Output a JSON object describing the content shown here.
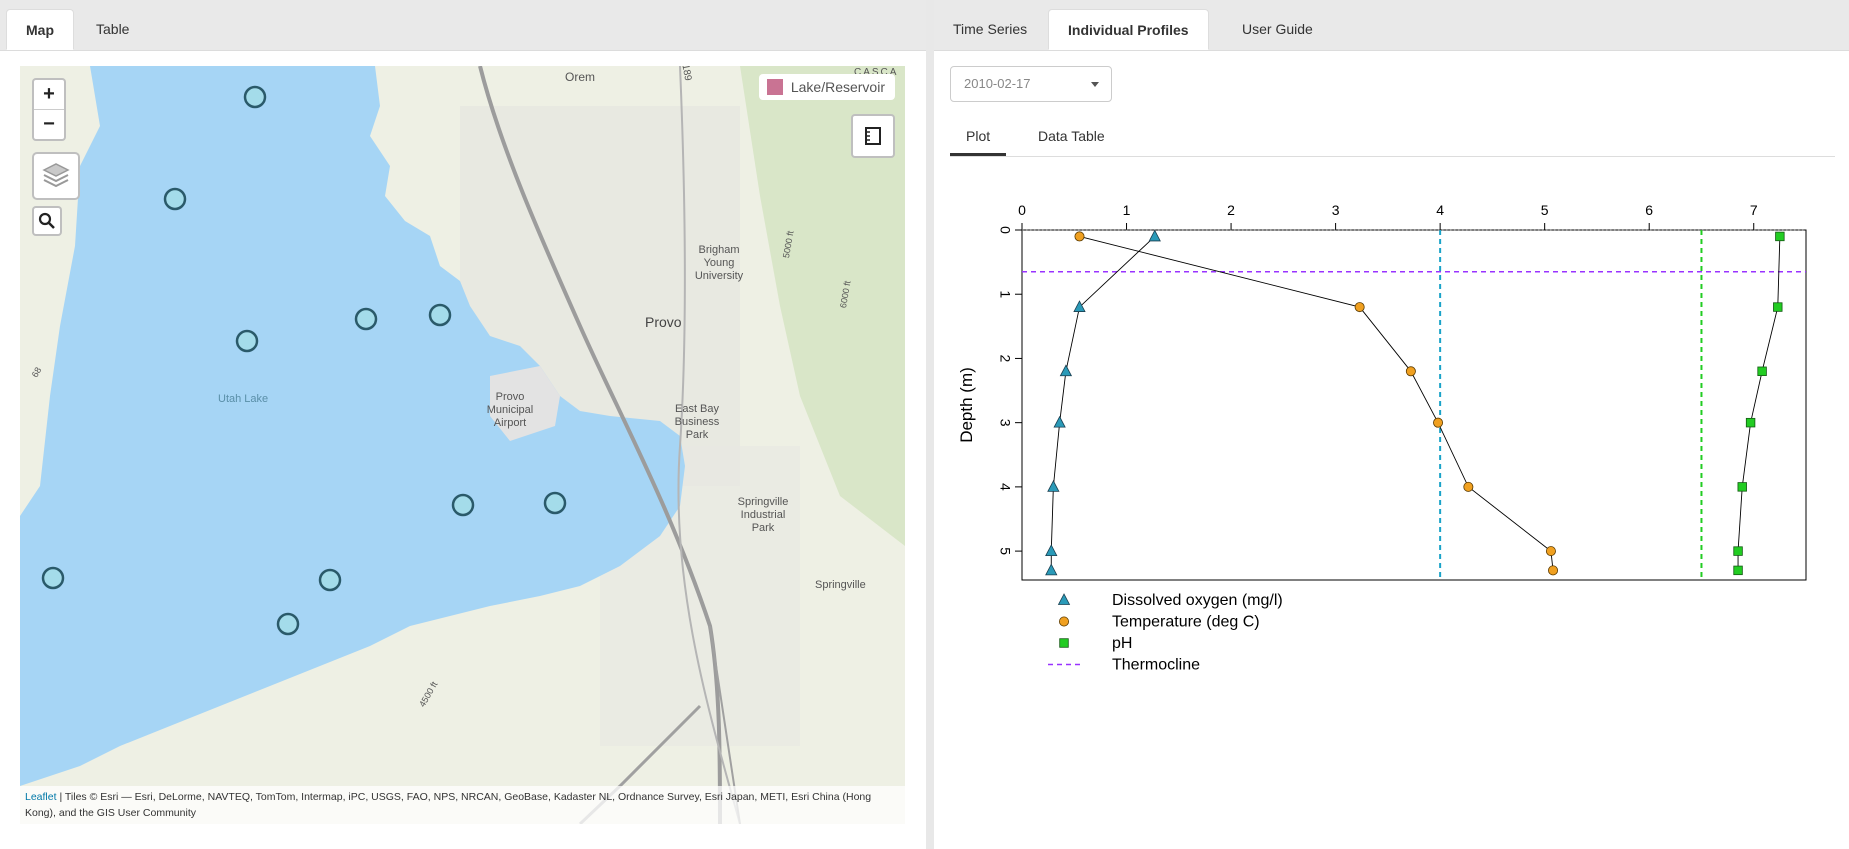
{
  "left_tabs": [
    {
      "label": "Map",
      "active": true
    },
    {
      "label": "Table",
      "active": false
    }
  ],
  "right_tabs": [
    {
      "label": "Time Series",
      "active": false
    },
    {
      "label": "Individual Profiles",
      "active": true
    },
    {
      "label": "User Guide",
      "active": false
    }
  ],
  "map": {
    "zoom_in": "+",
    "zoom_out": "−",
    "legend_label": "Lake/Reservoir",
    "legend_color": "#c97393",
    "place_labels": {
      "orem": "Orem",
      "provo": "Provo",
      "byu": "Brigham Young University",
      "airport": "Provo Municipal Airport",
      "east_bay": "East Bay Business Park",
      "springville_park": "Springville Industrial Park",
      "springville": "Springville",
      "utah_lake": "Utah Lake",
      "highway": "189",
      "road_68": "68",
      "scasca": "CASCA",
      "elev1": "5000 ft",
      "elev2": "4500 ft",
      "elev3": "6000 ft"
    },
    "attribution_link": "Leaflet",
    "attribution_text": " | Tiles © Esri — Esri, DeLorme, NAVTEQ, TomTom, Intermap, iPC, USGS, FAO, NPS, NRCAN, GeoBase, Kadaster NL, Ordnance Survey, Esri Japan, METI, Esri China (Hong Kong), and the GIS User Community",
    "lake_color": "#a6d5f5",
    "marker_color": "#a4dcea",
    "marker_stroke": "#2a5a6a"
  },
  "date_select": {
    "value": "2010-02-17"
  },
  "sub_tabs": [
    {
      "label": "Plot",
      "active": true
    },
    {
      "label": "Data Table",
      "active": false
    }
  ],
  "chart_data": {
    "type": "scatter",
    "xlabel": "",
    "ylabel": "Depth (m)",
    "xlim": [
      0,
      7.5
    ],
    "ylim": [
      0,
      5.45
    ],
    "x_ticks": [
      0,
      1,
      2,
      3,
      4,
      5,
      6,
      7
    ],
    "y_ticks": [
      0,
      1,
      2,
      3,
      4,
      5
    ],
    "y_inverted": true,
    "series": [
      {
        "name": "Dissolved oxygen (mg/l)",
        "marker": "triangle",
        "color": "#2a9ab8",
        "points": [
          [
            1.27,
            0.1
          ],
          [
            0.55,
            1.2
          ],
          [
            0.42,
            2.2
          ],
          [
            0.36,
            3.0
          ],
          [
            0.3,
            4.0
          ],
          [
            0.28,
            5.0
          ],
          [
            0.28,
            5.3
          ]
        ]
      },
      {
        "name": "Temperature (deg C)",
        "marker": "circle",
        "color": "#f0a020",
        "points": [
          [
            0.55,
            0.1
          ],
          [
            3.23,
            1.2
          ],
          [
            3.72,
            2.2
          ],
          [
            3.98,
            3.0
          ],
          [
            4.27,
            4.0
          ],
          [
            5.06,
            5.0
          ],
          [
            5.08,
            5.3
          ]
        ]
      },
      {
        "name": "pH",
        "marker": "square",
        "color": "#22cc22",
        "points": [
          [
            7.25,
            0.1
          ],
          [
            7.23,
            1.2
          ],
          [
            7.08,
            2.2
          ],
          [
            6.97,
            3.0
          ],
          [
            6.89,
            4.0
          ],
          [
            6.85,
            5.0
          ],
          [
            6.85,
            5.3
          ]
        ]
      }
    ],
    "lines": [
      {
        "name": "Thermocline",
        "type": "horizontal",
        "value": 0.65,
        "color": "#9933ff",
        "style": "dashed"
      },
      {
        "type": "vertical",
        "value": 4.0,
        "color": "#1aa3c8",
        "style": "dashed"
      },
      {
        "type": "vertical",
        "value": 6.5,
        "color": "#22cc22",
        "style": "dashed"
      },
      {
        "type": "horizontal",
        "value": 0.0,
        "color": "#555555",
        "style": "dotted"
      }
    ],
    "legend": [
      {
        "label": "Dissolved oxygen (mg/l)",
        "marker": "triangle",
        "color": "#2a9ab8"
      },
      {
        "label": "Temperature (deg C)",
        "marker": "circle",
        "color": "#f0a020"
      },
      {
        "label": "pH",
        "marker": "square",
        "color": "#22cc22"
      },
      {
        "label": "Thermocline",
        "marker": "dash",
        "color": "#9933ff"
      }
    ],
    "legend_position": "below"
  }
}
